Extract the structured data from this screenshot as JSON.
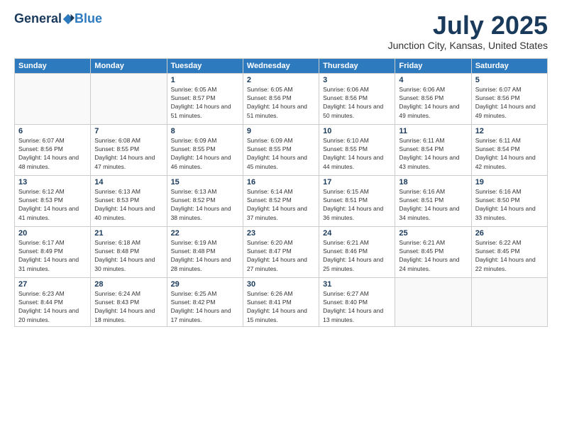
{
  "header": {
    "logo_general": "General",
    "logo_blue": "Blue",
    "title": "July 2025",
    "subtitle": "Junction City, Kansas, United States"
  },
  "calendar": {
    "days_of_week": [
      "Sunday",
      "Monday",
      "Tuesday",
      "Wednesday",
      "Thursday",
      "Friday",
      "Saturday"
    ],
    "weeks": [
      [
        {
          "num": "",
          "sunrise": "",
          "sunset": "",
          "daylight": ""
        },
        {
          "num": "",
          "sunrise": "",
          "sunset": "",
          "daylight": ""
        },
        {
          "num": "1",
          "sunrise": "Sunrise: 6:05 AM",
          "sunset": "Sunset: 8:57 PM",
          "daylight": "Daylight: 14 hours and 51 minutes."
        },
        {
          "num": "2",
          "sunrise": "Sunrise: 6:05 AM",
          "sunset": "Sunset: 8:56 PM",
          "daylight": "Daylight: 14 hours and 51 minutes."
        },
        {
          "num": "3",
          "sunrise": "Sunrise: 6:06 AM",
          "sunset": "Sunset: 8:56 PM",
          "daylight": "Daylight: 14 hours and 50 minutes."
        },
        {
          "num": "4",
          "sunrise": "Sunrise: 6:06 AM",
          "sunset": "Sunset: 8:56 PM",
          "daylight": "Daylight: 14 hours and 49 minutes."
        },
        {
          "num": "5",
          "sunrise": "Sunrise: 6:07 AM",
          "sunset": "Sunset: 8:56 PM",
          "daylight": "Daylight: 14 hours and 49 minutes."
        }
      ],
      [
        {
          "num": "6",
          "sunrise": "Sunrise: 6:07 AM",
          "sunset": "Sunset: 8:56 PM",
          "daylight": "Daylight: 14 hours and 48 minutes."
        },
        {
          "num": "7",
          "sunrise": "Sunrise: 6:08 AM",
          "sunset": "Sunset: 8:55 PM",
          "daylight": "Daylight: 14 hours and 47 minutes."
        },
        {
          "num": "8",
          "sunrise": "Sunrise: 6:09 AM",
          "sunset": "Sunset: 8:55 PM",
          "daylight": "Daylight: 14 hours and 46 minutes."
        },
        {
          "num": "9",
          "sunrise": "Sunrise: 6:09 AM",
          "sunset": "Sunset: 8:55 PM",
          "daylight": "Daylight: 14 hours and 45 minutes."
        },
        {
          "num": "10",
          "sunrise": "Sunrise: 6:10 AM",
          "sunset": "Sunset: 8:55 PM",
          "daylight": "Daylight: 14 hours and 44 minutes."
        },
        {
          "num": "11",
          "sunrise": "Sunrise: 6:11 AM",
          "sunset": "Sunset: 8:54 PM",
          "daylight": "Daylight: 14 hours and 43 minutes."
        },
        {
          "num": "12",
          "sunrise": "Sunrise: 6:11 AM",
          "sunset": "Sunset: 8:54 PM",
          "daylight": "Daylight: 14 hours and 42 minutes."
        }
      ],
      [
        {
          "num": "13",
          "sunrise": "Sunrise: 6:12 AM",
          "sunset": "Sunset: 8:53 PM",
          "daylight": "Daylight: 14 hours and 41 minutes."
        },
        {
          "num": "14",
          "sunrise": "Sunrise: 6:13 AM",
          "sunset": "Sunset: 8:53 PM",
          "daylight": "Daylight: 14 hours and 40 minutes."
        },
        {
          "num": "15",
          "sunrise": "Sunrise: 6:13 AM",
          "sunset": "Sunset: 8:52 PM",
          "daylight": "Daylight: 14 hours and 38 minutes."
        },
        {
          "num": "16",
          "sunrise": "Sunrise: 6:14 AM",
          "sunset": "Sunset: 8:52 PM",
          "daylight": "Daylight: 14 hours and 37 minutes."
        },
        {
          "num": "17",
          "sunrise": "Sunrise: 6:15 AM",
          "sunset": "Sunset: 8:51 PM",
          "daylight": "Daylight: 14 hours and 36 minutes."
        },
        {
          "num": "18",
          "sunrise": "Sunrise: 6:16 AM",
          "sunset": "Sunset: 8:51 PM",
          "daylight": "Daylight: 14 hours and 34 minutes."
        },
        {
          "num": "19",
          "sunrise": "Sunrise: 6:16 AM",
          "sunset": "Sunset: 8:50 PM",
          "daylight": "Daylight: 14 hours and 33 minutes."
        }
      ],
      [
        {
          "num": "20",
          "sunrise": "Sunrise: 6:17 AM",
          "sunset": "Sunset: 8:49 PM",
          "daylight": "Daylight: 14 hours and 31 minutes."
        },
        {
          "num": "21",
          "sunrise": "Sunrise: 6:18 AM",
          "sunset": "Sunset: 8:48 PM",
          "daylight": "Daylight: 14 hours and 30 minutes."
        },
        {
          "num": "22",
          "sunrise": "Sunrise: 6:19 AM",
          "sunset": "Sunset: 8:48 PM",
          "daylight": "Daylight: 14 hours and 28 minutes."
        },
        {
          "num": "23",
          "sunrise": "Sunrise: 6:20 AM",
          "sunset": "Sunset: 8:47 PM",
          "daylight": "Daylight: 14 hours and 27 minutes."
        },
        {
          "num": "24",
          "sunrise": "Sunrise: 6:21 AM",
          "sunset": "Sunset: 8:46 PM",
          "daylight": "Daylight: 14 hours and 25 minutes."
        },
        {
          "num": "25",
          "sunrise": "Sunrise: 6:21 AM",
          "sunset": "Sunset: 8:45 PM",
          "daylight": "Daylight: 14 hours and 24 minutes."
        },
        {
          "num": "26",
          "sunrise": "Sunrise: 6:22 AM",
          "sunset": "Sunset: 8:45 PM",
          "daylight": "Daylight: 14 hours and 22 minutes."
        }
      ],
      [
        {
          "num": "27",
          "sunrise": "Sunrise: 6:23 AM",
          "sunset": "Sunset: 8:44 PM",
          "daylight": "Daylight: 14 hours and 20 minutes."
        },
        {
          "num": "28",
          "sunrise": "Sunrise: 6:24 AM",
          "sunset": "Sunset: 8:43 PM",
          "daylight": "Daylight: 14 hours and 18 minutes."
        },
        {
          "num": "29",
          "sunrise": "Sunrise: 6:25 AM",
          "sunset": "Sunset: 8:42 PM",
          "daylight": "Daylight: 14 hours and 17 minutes."
        },
        {
          "num": "30",
          "sunrise": "Sunrise: 6:26 AM",
          "sunset": "Sunset: 8:41 PM",
          "daylight": "Daylight: 14 hours and 15 minutes."
        },
        {
          "num": "31",
          "sunrise": "Sunrise: 6:27 AM",
          "sunset": "Sunset: 8:40 PM",
          "daylight": "Daylight: 14 hours and 13 minutes."
        },
        {
          "num": "",
          "sunrise": "",
          "sunset": "",
          "daylight": ""
        },
        {
          "num": "",
          "sunrise": "",
          "sunset": "",
          "daylight": ""
        }
      ]
    ]
  }
}
